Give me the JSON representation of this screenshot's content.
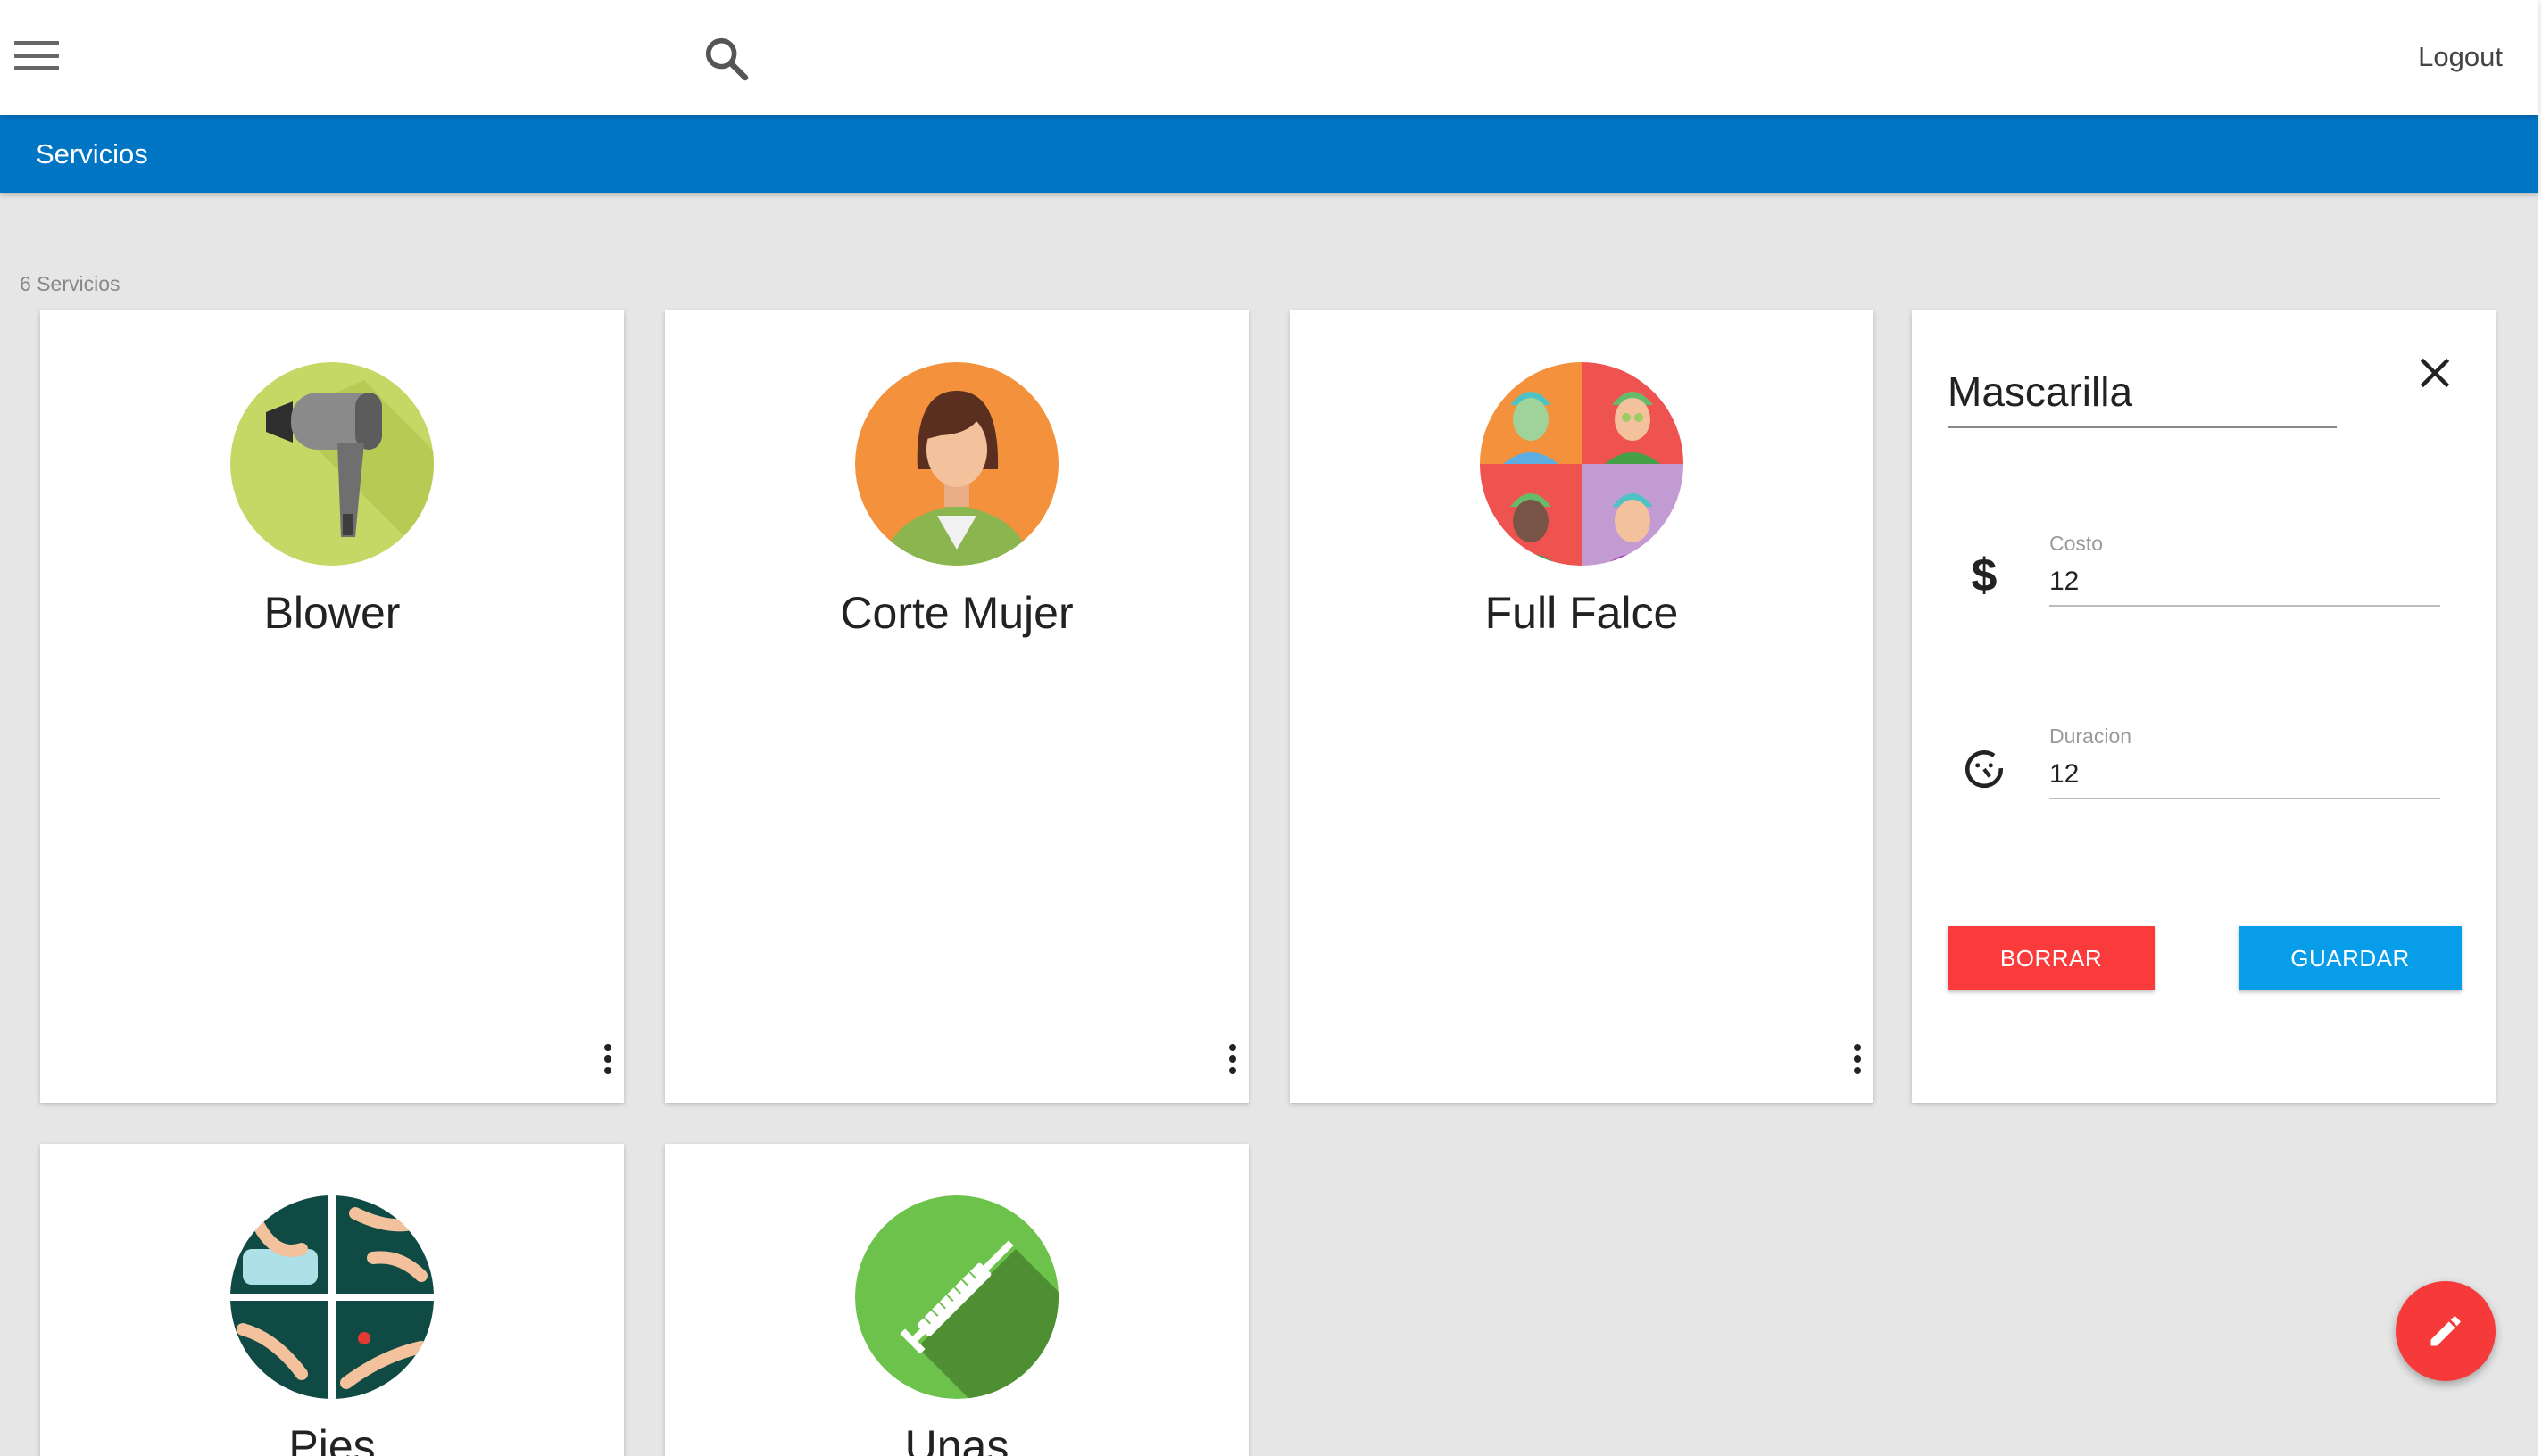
{
  "topbar": {
    "menu_icon": "hamburger-menu-icon",
    "search_icon": "search-icon",
    "logout_label": "Logout"
  },
  "header": {
    "title": "Servicios"
  },
  "services_count": "6 Servicios",
  "services": [
    {
      "name": "Blower",
      "icon": "hair-dryer-icon",
      "accent": "#c5d764"
    },
    {
      "name": "Corte Mujer",
      "icon": "woman-avatar-icon",
      "accent": "#f3913c"
    },
    {
      "name": "Full Falce",
      "icon": "face-mask-collage-icon",
      "accent": "#ef5350"
    },
    {
      "name": "Pies",
      "icon": "pedicure-collage-icon",
      "accent": "#0f4a45"
    },
    {
      "name": "Unas",
      "icon": "syringe-icon",
      "accent": "#6cc24a"
    }
  ],
  "edit_form": {
    "name_value": "Mascarilla",
    "cost_label": "Costo",
    "cost_value": "12",
    "duration_label": "Duracion",
    "duration_value": "12",
    "delete_label": "BORRAR",
    "save_label": "GUARDAR",
    "delete_color": "#fb3b3b",
    "save_color": "#079de9"
  },
  "fab": {
    "icon": "pencil-icon",
    "color": "#f63a3a"
  },
  "colors": {
    "header": "#0075c4",
    "background": "#e6e6e6"
  }
}
